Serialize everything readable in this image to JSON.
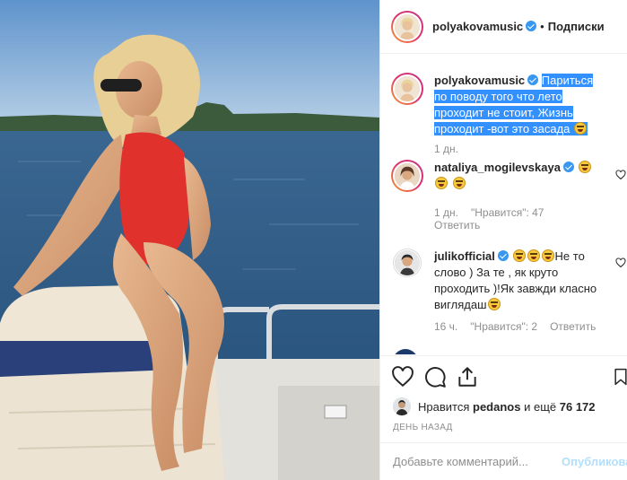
{
  "header": {
    "username": "polyakovamusic",
    "separator": "•",
    "follow_label": "Подписки"
  },
  "comments": [
    {
      "username": "polyakovamusic",
      "text": "Париться по поводу того что лето проходит не стоит, Жизнь проходит -вот это засада",
      "time": "1 дн.",
      "highlighted": true
    },
    {
      "username": "nataliya_mogilevskaya",
      "text": "",
      "time": "1 дн.",
      "likes_label": "\"Нравится\": 47",
      "reply_label": "Ответить"
    },
    {
      "username": "julikofficial",
      "text": "Не то слово ) За те , як круто проходить )!Як завжди класно виглядаш",
      "time": "16 ч.",
      "likes_label": "\"Нравится\": 2",
      "reply_label": "Ответить"
    }
  ],
  "likes": {
    "prefix": "Нравится",
    "user": "pedanos",
    "middle": "и ещё",
    "count": "76 172"
  },
  "posted": "ДЕНЬ НАЗАД",
  "add_comment": {
    "placeholder": "Добавьте комментарий...",
    "publish_label": "Опубликовать"
  },
  "icons": [
    "heart-icon",
    "comment-icon",
    "share-icon",
    "bookmark-icon",
    "verified-badge",
    "smile-emoji"
  ],
  "colors": {
    "verified": "#3897f0",
    "selection": "#3390ff",
    "muted": "#8e8e8e",
    "publish": "#b2dffc"
  }
}
